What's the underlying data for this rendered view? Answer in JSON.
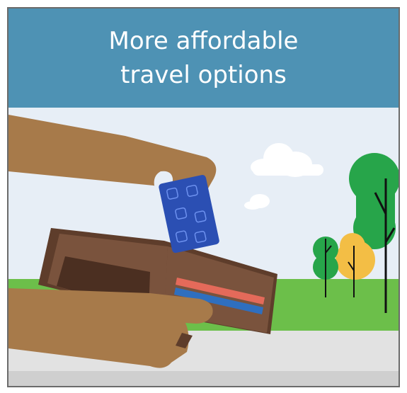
{
  "header": {
    "title": "More affordable travel options"
  },
  "colors": {
    "header_bg": "#4e92b4",
    "sky": "#e7eef6",
    "grass": "#6cbf4a",
    "road": "#e0e0e0",
    "skin": "#a77a4a",
    "wallet": "#6e4a35",
    "card": "#2b4fb3",
    "red_card": "#e46a5a",
    "blue_card": "#2f6fbf",
    "tree_green": "#27a54a",
    "tree_yellow": "#f3be45"
  },
  "icons": [
    "cloud-icon",
    "tree-icon",
    "wallet-icon",
    "transit-card-icon",
    "hand-icon"
  ]
}
